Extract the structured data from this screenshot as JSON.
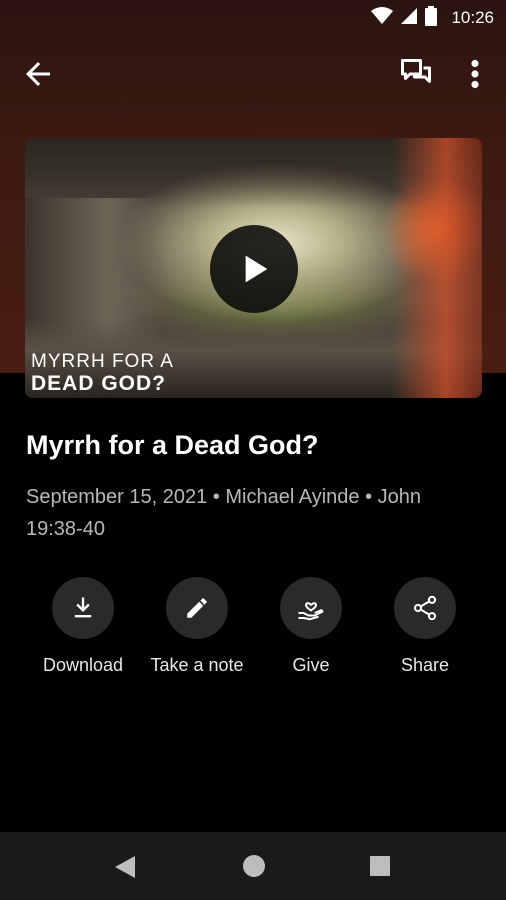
{
  "status_bar": {
    "time": "10:26"
  },
  "hero": {
    "series_title_line1": "MYRRH FOR A",
    "series_title_line2": "DEAD GOD?"
  },
  "sermon": {
    "title": "Myrrh for a Dead God?",
    "meta": "September 15, 2021 • Michael Ayinde • John 19:38-40"
  },
  "actions": [
    {
      "label": "Download",
      "icon": "download-icon"
    },
    {
      "label": "Take a note",
      "icon": "pencil-icon"
    },
    {
      "label": "Give",
      "icon": "give-hand-heart-icon"
    },
    {
      "label": "Share",
      "icon": "share-icon"
    }
  ],
  "colors": {
    "background": "#000000",
    "top_gradient": "#4a1d12",
    "action_circle": "#2a2a2a",
    "meta_text": "#b8b8b8",
    "nav_bar": "#1a1a1a"
  }
}
